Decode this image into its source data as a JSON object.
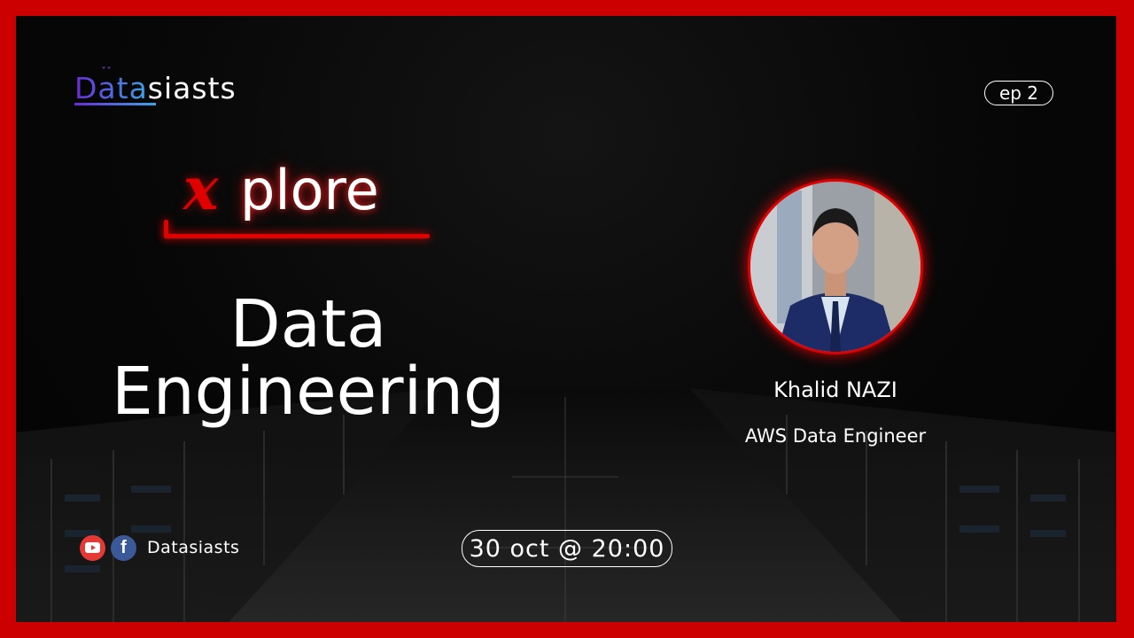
{
  "brand": {
    "logo_part1": "Data",
    "logo_part2": "siasts",
    "gradient_start": "#6a2bd8",
    "gradient_end": "#3aa4e8"
  },
  "episode": "ep 2",
  "series": {
    "x_letter": "x",
    "rest": "plore"
  },
  "title": {
    "line1": "Data",
    "line2": "Engineering"
  },
  "speaker": {
    "name": "Khalid NAZI",
    "role": "AWS Data Engineer"
  },
  "social": {
    "icons": [
      "youtube-icon",
      "facebook-icon"
    ],
    "label": "Datasiasts"
  },
  "schedule": "30 oct @ 20:00",
  "colors": {
    "frame": "#cc0000",
    "accent": "#e00000",
    "background": "#070707"
  }
}
